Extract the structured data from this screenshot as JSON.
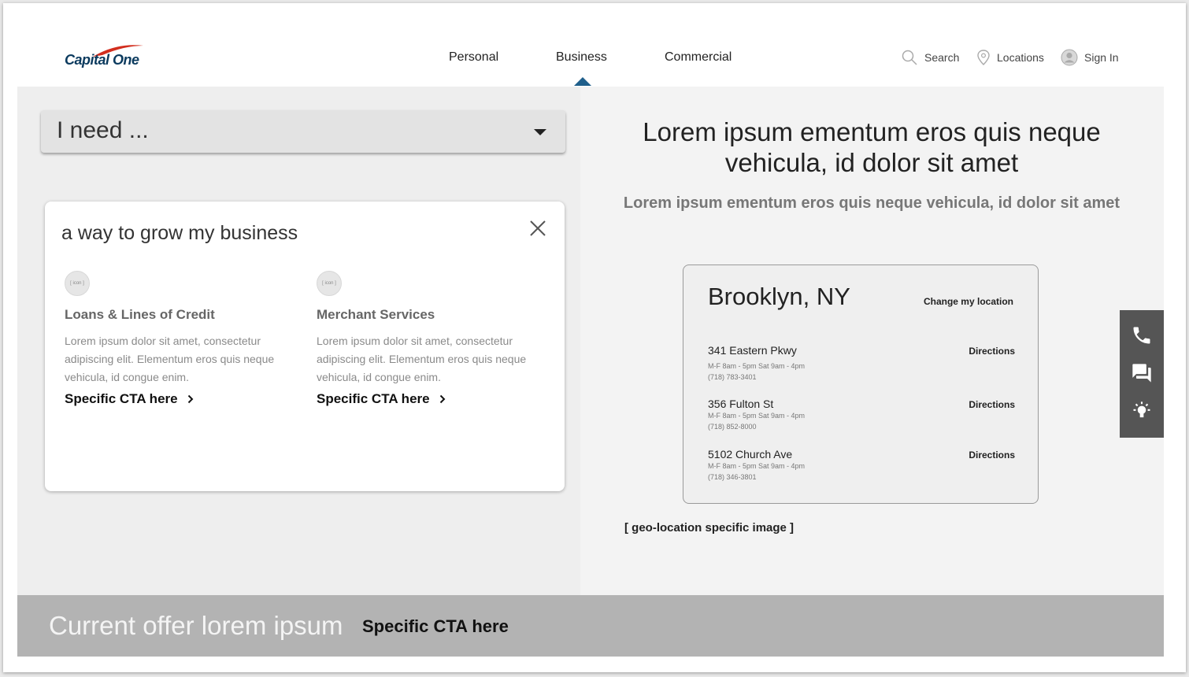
{
  "header": {
    "logo_text": "Capital One",
    "nav": {
      "personal": "Personal",
      "business": "Business",
      "commercial": "Commercial",
      "active": "Business"
    },
    "utility": {
      "search": "Search",
      "locations": "Locations",
      "sign_in": "Sign In"
    }
  },
  "left": {
    "need_dropdown_label": "I need ...",
    "card": {
      "title": "a way to grow my business",
      "services": [
        {
          "icon_label": "[ icon ]",
          "title": "Loans & Lines of Credit",
          "description": "Lorem ipsum dolor sit amet, consectetur adipiscing elit.  Elementum eros quis neque vehicula, id congue enim.",
          "cta": "Specific CTA here"
        },
        {
          "icon_label": "[ icon ]",
          "title": "Merchant Services",
          "description": "Lorem ipsum dolor sit amet, consectetur adipiscing elit.  Elementum eros quis neque vehicula, id congue enim.",
          "cta": "Specific CTA here"
        }
      ]
    }
  },
  "right": {
    "hero_title": "Lorem ipsum ementum eros quis neque vehicula, id dolor sit amet",
    "hero_subtitle": "Lorem ipsum ementum eros quis neque vehicula, id dolor sit amet",
    "location_card": {
      "city": "Brooklyn, NY",
      "change_link": "Change my location",
      "branches": [
        {
          "address": "341 Eastern Pkwy",
          "hours": "M-F 8am - 5pm Sat 9am - 4pm",
          "phone": "(718) 783-3401",
          "directions": "Directions"
        },
        {
          "address": "356 Fulton St",
          "hours": "M-F 8am - 5pm Sat 9am - 4pm",
          "phone": "(718) 852-8000",
          "directions": "Directions"
        },
        {
          "address": "5102 Church Ave",
          "hours": "M-F 8am - 5pm Sat 9am - 4pm",
          "phone": "(718) 346-3801",
          "directions": "Directions"
        }
      ]
    },
    "image_caption": "[ geo-location specific image ]"
  },
  "side_tools": [
    "phone-icon",
    "chat-icon",
    "lightbulb-icon"
  ],
  "offer_bar": {
    "text": "Current offer lorem ipsum",
    "cta": "Specific CTA here"
  },
  "colors": {
    "brand_navy": "#0b3a5e",
    "brand_red": "#d22e1e",
    "nav_indicator": "#1f5f8b",
    "offer_bar_bg": "#b3b3b3",
    "side_tools_bg": "#555555"
  }
}
